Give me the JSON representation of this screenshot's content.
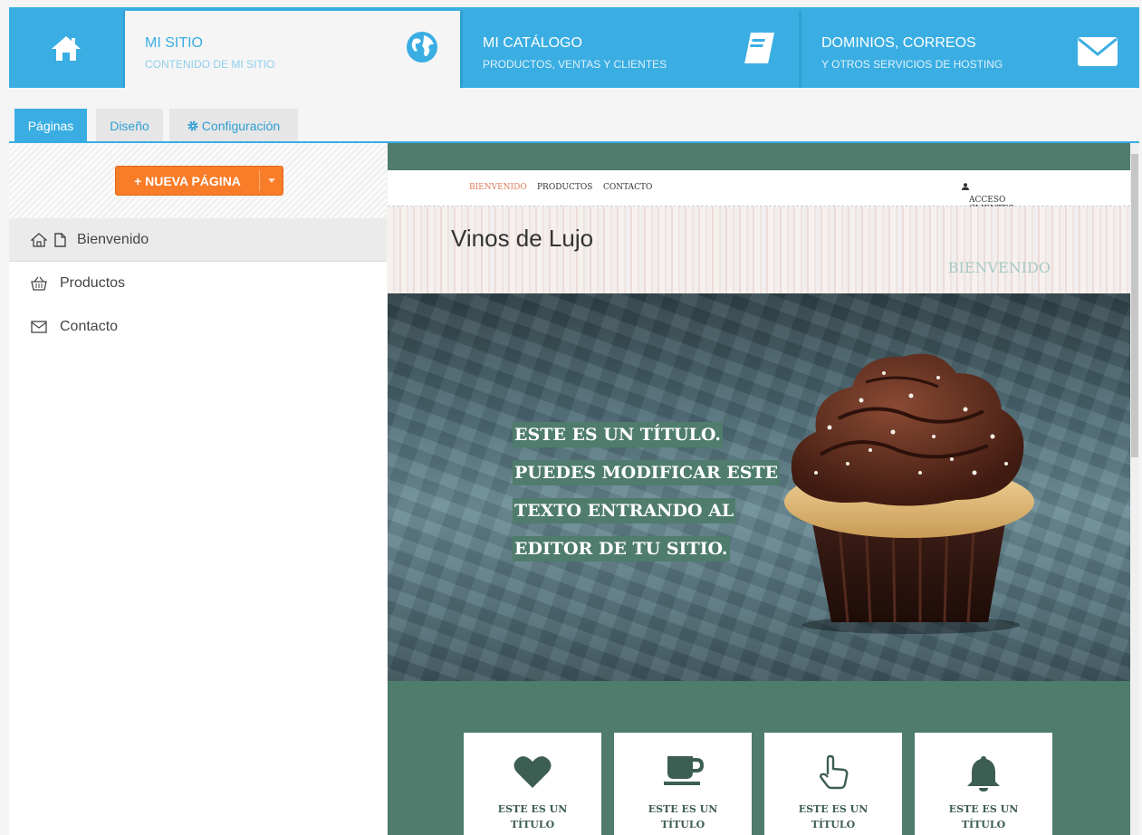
{
  "topnav": {
    "items": [
      {
        "title": "MI SITIO",
        "subtitle": "CONTENIDO DE MI SITIO",
        "icon": "globe-icon"
      },
      {
        "title": "MI CATÁLOGO",
        "subtitle": "PRODUCTOS, VENTAS Y CLIENTES",
        "icon": "book-icon"
      },
      {
        "title": "DOMINIOS, CORREOS",
        "subtitle": "Y OTROS SERVICIOS DE HOSTING",
        "icon": "envelope-icon"
      }
    ]
  },
  "subtabs": {
    "pages": "Páginas",
    "design": "Diseño",
    "config": "Configuración"
  },
  "leftpanel": {
    "new_page": "+ NUEVA PÁGINA",
    "pages": [
      {
        "label": "Bienvenido"
      },
      {
        "label": "Productos"
      },
      {
        "label": "Contacto"
      }
    ]
  },
  "preview": {
    "nav": {
      "items": [
        "BIENVENIDO",
        "PRODUCTOS",
        "CONTACTO"
      ],
      "client_access": "ACCESO CLIENTES"
    },
    "site_title": "Vinos de Lujo",
    "page_heading": "BIENVENIDO",
    "hero_lines": [
      "ESTE ES UN TÍTULO.",
      "PUEDES MODIFICAR ESTE",
      "TEXTO ENTRANDO AL",
      "EDITOR DE TU SITIO."
    ],
    "features": [
      {
        "icon": "heart-icon",
        "title_1": "ESTE ES UN",
        "title_2": "TÍTULO"
      },
      {
        "icon": "coffee-cup-icon",
        "title_1": "ESTE ES UN",
        "title_2": "TÍTULO"
      },
      {
        "icon": "hand-pointer-icon",
        "title_1": "ESTE ES UN",
        "title_2": "TÍTULO"
      },
      {
        "icon": "bell-icon",
        "title_1": "ESTE ES UN",
        "title_2": "TÍTULO"
      }
    ]
  },
  "colors": {
    "accent": "#3aaee3",
    "button": "#f97c28",
    "preview_green": "#4f7c6c",
    "nav_active": "#e07a5a"
  }
}
